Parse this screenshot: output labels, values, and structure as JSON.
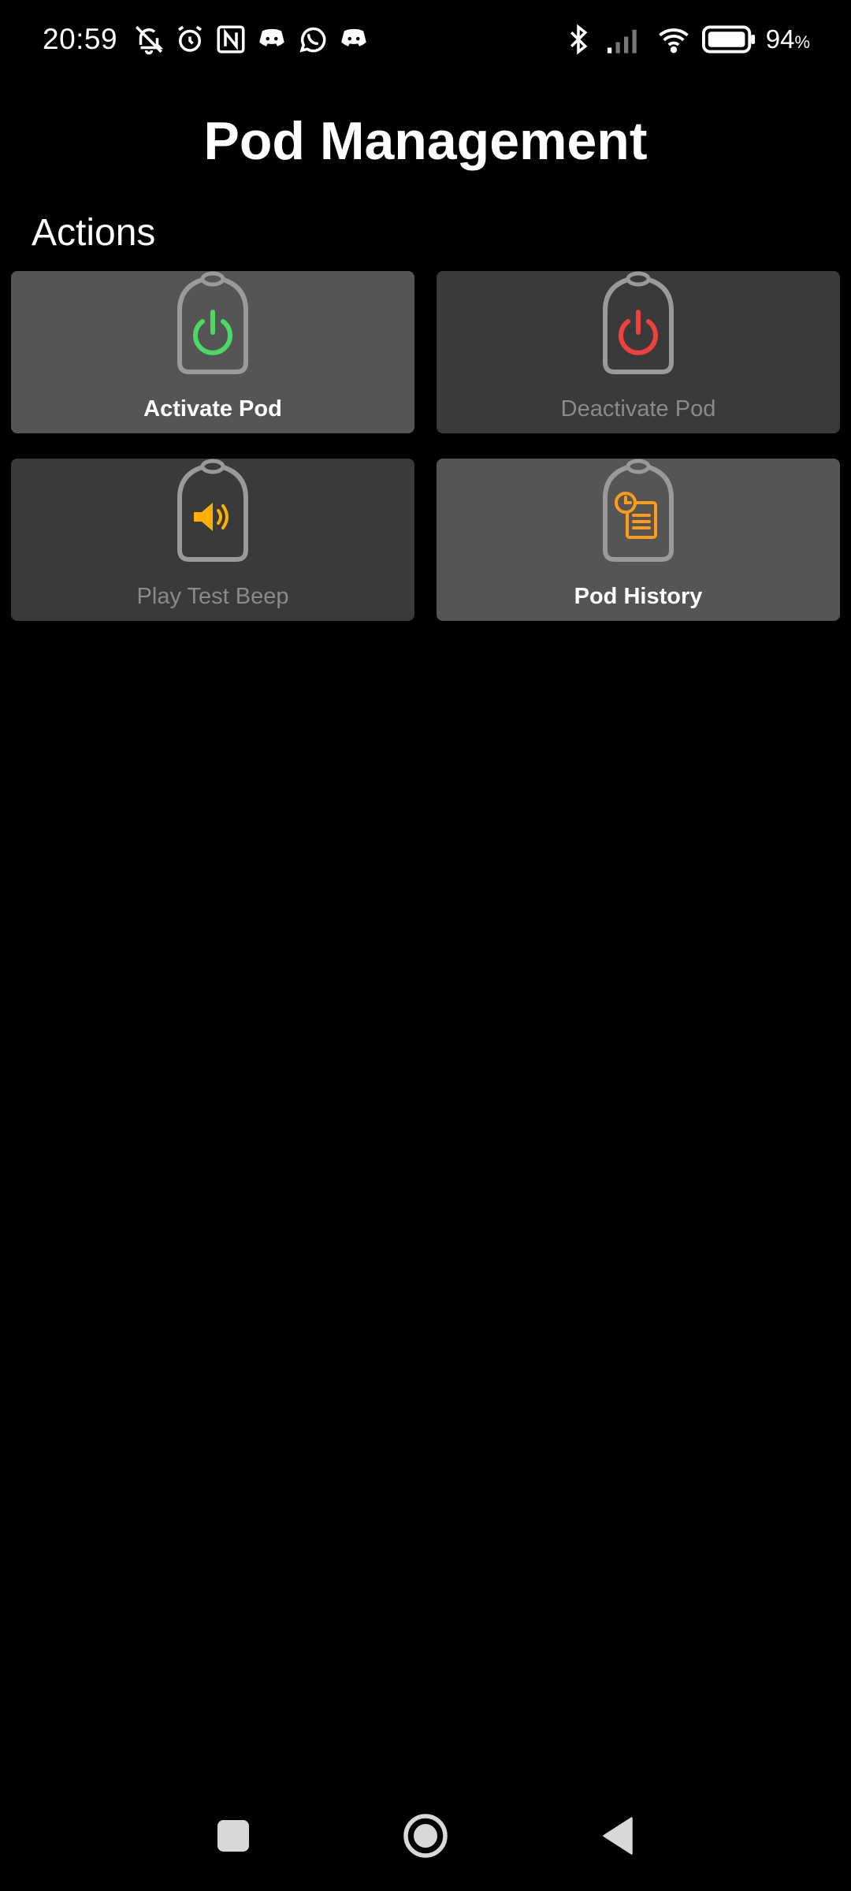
{
  "status_bar": {
    "time": "20:59",
    "battery_percent": "94",
    "battery_percent_sign": "%",
    "left_icons": [
      "muted-bell-icon",
      "alarm-icon",
      "nfc-icon",
      "discord-icon",
      "whatsapp-icon",
      "discord-icon"
    ],
    "right_icons": [
      "bluetooth-icon",
      "signal-icon",
      "wifi-icon",
      "battery-icon"
    ]
  },
  "header": {
    "title": "Pod Management"
  },
  "actions": {
    "section_title": "Actions",
    "items": [
      {
        "label": "Activate Pod",
        "icon": "power-icon",
        "icon_color": "#4cd964",
        "enabled": true
      },
      {
        "label": "Deactivate Pod",
        "icon": "power-icon",
        "icon_color": "#f04040",
        "enabled": false
      },
      {
        "label": "Play Test Beep",
        "icon": "speaker-icon",
        "icon_color": "#ffb000",
        "enabled": false
      },
      {
        "label": "Pod History",
        "icon": "history-icon",
        "icon_color": "#ff9a1a",
        "enabled": true
      }
    ]
  },
  "nav_bar": {
    "buttons": [
      "recents-icon",
      "home-icon",
      "back-icon"
    ]
  },
  "colors": {
    "background": "#000000",
    "tile_enabled": "#555555",
    "tile_disabled": "#3a3a3a",
    "pod_outline": "#9a9a9a"
  }
}
